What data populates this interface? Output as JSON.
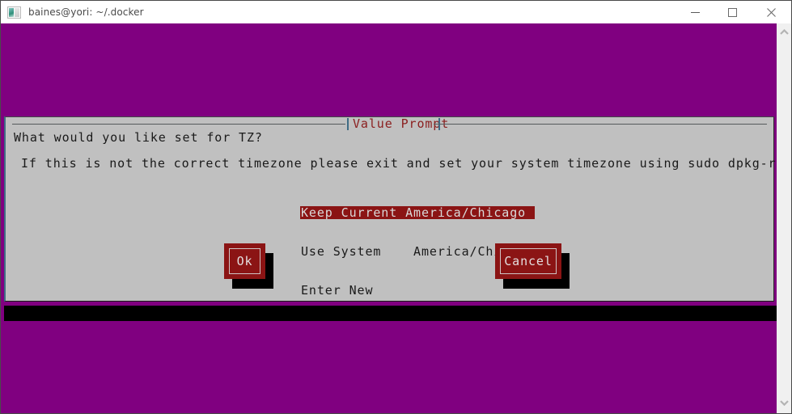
{
  "window": {
    "title": "baines@yori: ~/.docker",
    "icon": "terminal-icon",
    "controls": {
      "minimize": "—",
      "maximize": "□",
      "close": "✕"
    }
  },
  "colors": {
    "terminal_background": "#800080",
    "dialog_background": "#c0c0c0",
    "accent_red": "#8b1414",
    "title_red": "#8b2020",
    "black_band": "#000000",
    "titlebar_background": "#ffffff",
    "title_text": "#4a4a4a"
  },
  "scrollbar": {
    "up_arrow": "chevron-up-icon",
    "down_arrow": "chevron-down-icon"
  },
  "dialog": {
    "title": "Value Prompt",
    "question": "What would you like set for TZ?",
    "note": "If this is not the correct timezone please exit and set your system timezone using sudo dpkg-reconfigure tzdata",
    "options": [
      {
        "label": "Keep Current America/Chicago",
        "selected": true
      },
      {
        "label": "Use System    America/Chicago",
        "selected": false
      },
      {
        "label": "Enter New",
        "selected": false
      }
    ],
    "buttons": {
      "ok": "Ok",
      "cancel": "Cancel"
    }
  }
}
